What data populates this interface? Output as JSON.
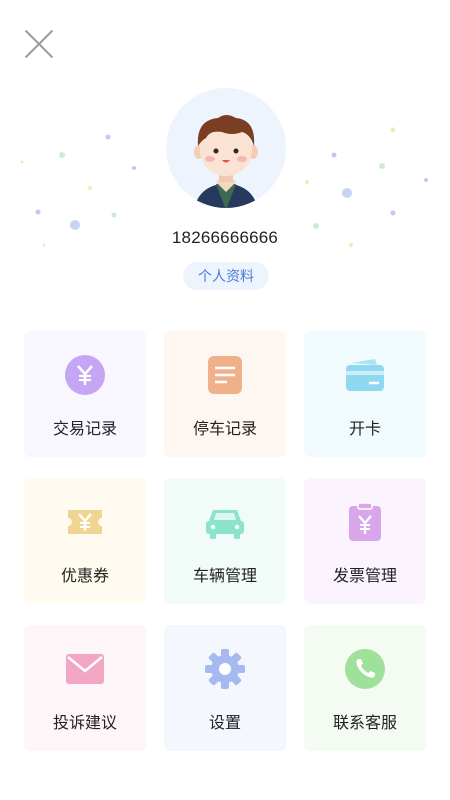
{
  "header": {
    "close_icon": "close-icon",
    "phone": "18266666666",
    "profile_button": "个人资料"
  },
  "menu": [
    {
      "label": "交易记录",
      "icon": "yuan-coin-icon",
      "bg": "#f8f6fe",
      "color": "#c4a6f4"
    },
    {
      "label": "停车记录",
      "icon": "document-icon",
      "bg": "#fdf6f1",
      "color": "#f0b18a"
    },
    {
      "label": "开卡",
      "icon": "card-icon",
      "bg": "#f1fbfd",
      "color": "#8ed9ef"
    },
    {
      "label": "优惠券",
      "icon": "coupon-icon",
      "bg": "#fffbf0",
      "color": "#efd591"
    },
    {
      "label": "车辆管理",
      "icon": "car-icon",
      "bg": "#f1fcf8",
      "color": "#8be3c9"
    },
    {
      "label": "发票管理",
      "icon": "invoice-icon",
      "bg": "#fbf3fd",
      "color": "#d9a6ec"
    },
    {
      "label": "投诉建议",
      "icon": "mail-icon",
      "bg": "#fdf5f8",
      "color": "#f3a6c3"
    },
    {
      "label": "设置",
      "icon": "gear-icon",
      "bg": "#f4f7fe",
      "color": "#a7b9f1"
    },
    {
      "label": "联系客服",
      "icon": "phone-icon",
      "bg": "#f3fbf2",
      "color": "#9fe09b"
    }
  ]
}
